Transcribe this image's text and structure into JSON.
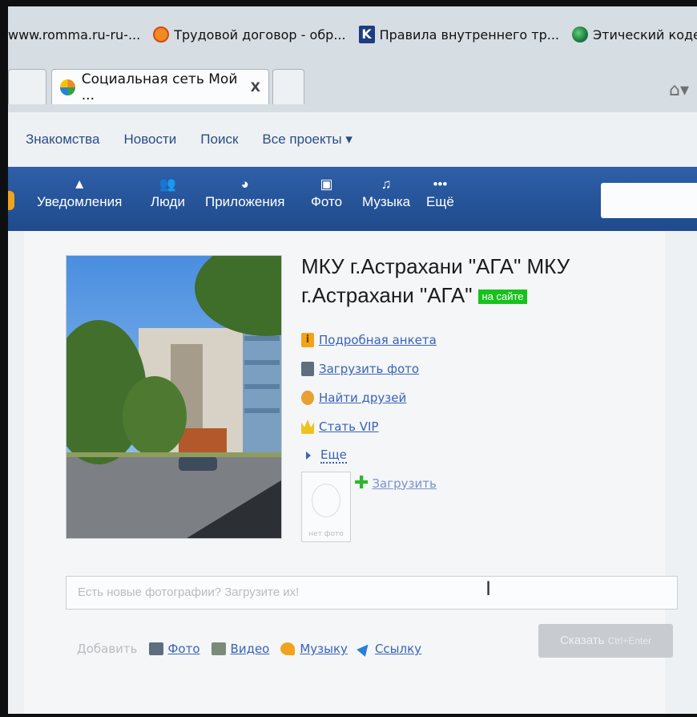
{
  "bookmarks": [
    {
      "label": "www.romma.ru-ru-...",
      "icon": "none"
    },
    {
      "label": "Трудовой договор - обр...",
      "icon": "orange-circle-icon"
    },
    {
      "label": "Правила внутреннего тр...",
      "icon": "k-logo-icon"
    },
    {
      "label": "Этический кодекс",
      "icon": "globe-icon"
    }
  ],
  "tabs": {
    "active_title": "Социальная сеть Мой ...",
    "close_label": "X"
  },
  "site_nav": {
    "items": [
      "Знакомства",
      "Новости",
      "Поиск",
      "Все проекты ▾"
    ]
  },
  "toolbar": {
    "items": [
      {
        "label": "Уведомления",
        "icon": "bell-icon",
        "glyph": "▲"
      },
      {
        "label": "Люди",
        "icon": "people-icon",
        "glyph": "👥"
      },
      {
        "label": "Приложения",
        "icon": "apps-icon",
        "glyph": "◕"
      },
      {
        "label": "Фото",
        "icon": "photo-icon",
        "glyph": "▣"
      },
      {
        "label": "Музыка",
        "icon": "music-icon",
        "glyph": "♫"
      },
      {
        "label": "Ещё",
        "icon": "more-icon",
        "glyph": "•••"
      }
    ]
  },
  "profile": {
    "name": "МКУ г.Астрахани \"АГА\" МКУ г.Астрахани \"АГА\"",
    "status_badge": "на сайте",
    "links": {
      "details": "Подробная анкета",
      "upload_photo": "Загрузить фото",
      "find_friends": "Найти друзей",
      "vip": "Стать VIP",
      "more": "Еще"
    },
    "thumb_caption": "нет фото",
    "upload": "Загрузить"
  },
  "post": {
    "placeholder": "Есть новые фотографии? Загрузите их!",
    "add_label": "Добавить",
    "attach": {
      "photo": "Фото",
      "video": "Видео",
      "music": "Музыку",
      "link": "Ссылку"
    },
    "submit": "Сказать",
    "shortcut": "Ctrl+Enter"
  },
  "colors": {
    "toolbar": "#1f4b8d",
    "link": "#3a62b8",
    "online": "#18c21c"
  }
}
